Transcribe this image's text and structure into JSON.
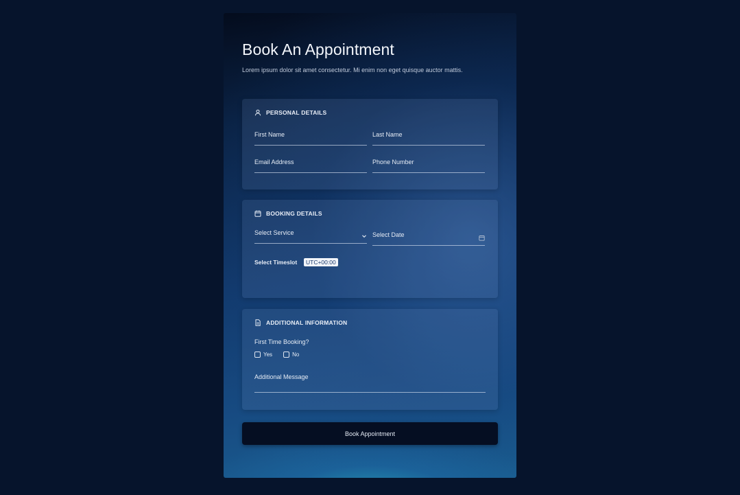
{
  "form": {
    "title": "Book An Appointment",
    "subtitle": "Lorem ipsum dolor sit amet consectetur. Mi enim non eget quisque auctor mattis."
  },
  "personal": {
    "heading": "PERSONAL DETAILS",
    "icon": "user-icon",
    "first_name": "First Name",
    "last_name": "Last Name",
    "email": "Email Address",
    "phone": "Phone Number"
  },
  "booking": {
    "heading": "BOOKING DETAILS",
    "icon": "calendar-icon",
    "service": "Select Service",
    "date": "Select Date",
    "timeslot_label": "Select Timeslot",
    "timezone": "UTC+00:00"
  },
  "additional": {
    "heading": "ADDITIONAL INFORMATION",
    "icon": "document-icon",
    "question": "First Time Booking?",
    "yes": "Yes",
    "no": "No",
    "message": "Additional Message"
  },
  "submit_label": "Book Appointment",
  "colors": {
    "page_background": "#06142c",
    "button_background": "#050e22",
    "accent_glow": "#2396b4"
  }
}
